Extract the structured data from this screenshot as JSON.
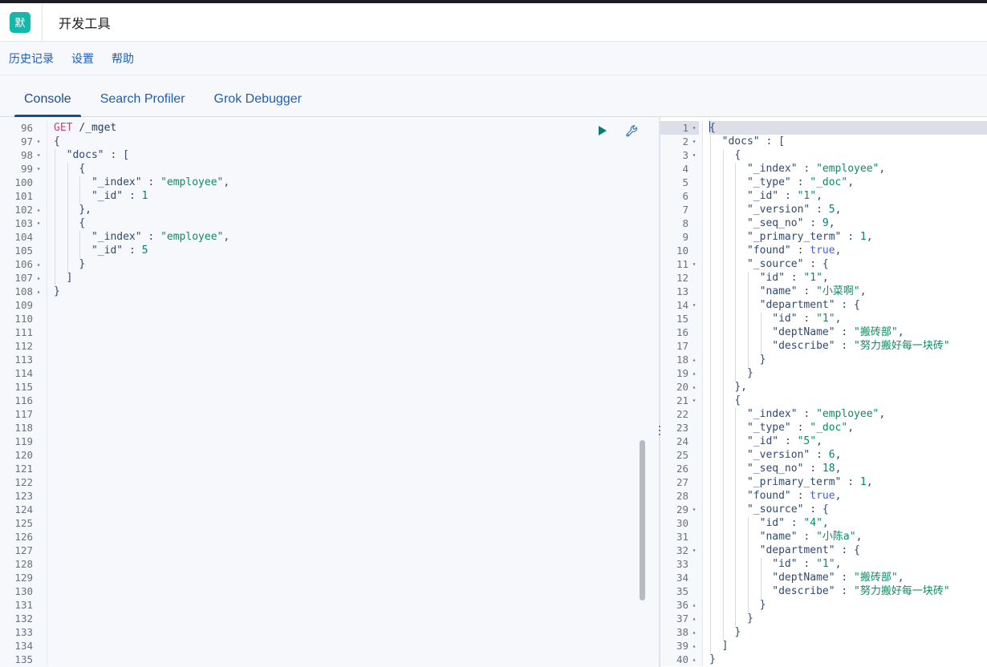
{
  "app": {
    "logo_text": "默",
    "title": "开发工具"
  },
  "nav": {
    "links": [
      {
        "label": "历史记录",
        "name": "history"
      },
      {
        "label": "设置",
        "name": "settings"
      },
      {
        "label": "帮助",
        "name": "help"
      }
    ]
  },
  "tabs": [
    {
      "label": "Console",
      "active": true
    },
    {
      "label": "Search Profiler",
      "active": false
    },
    {
      "label": "Grok Debugger",
      "active": false
    }
  ],
  "toolbar": {
    "send_icon": "play-icon",
    "send_label": "Click to send request",
    "wrench_icon": "wrench-icon",
    "wrench_label": "Open documentation"
  },
  "request_editor": {
    "first_line_number": 96,
    "last_line_number": 135,
    "lines": [
      {
        "n": 96,
        "fold": "",
        "text": "GET /_mget"
      },
      {
        "n": 97,
        "fold": "▾",
        "text": "{"
      },
      {
        "n": 98,
        "fold": "▾",
        "text": "  \"docs\" : ["
      },
      {
        "n": 99,
        "fold": "▾",
        "text": "    {"
      },
      {
        "n": 100,
        "fold": "",
        "text": "      \"_index\" : \"employee\","
      },
      {
        "n": 101,
        "fold": "",
        "text": "      \"_id\" : 1"
      },
      {
        "n": 102,
        "fold": "▴",
        "text": "    },"
      },
      {
        "n": 103,
        "fold": "▾",
        "text": "    {"
      },
      {
        "n": 104,
        "fold": "",
        "text": "      \"_index\" : \"employee\","
      },
      {
        "n": 105,
        "fold": "",
        "text": "      \"_id\" : 5"
      },
      {
        "n": 106,
        "fold": "▴",
        "text": "    }"
      },
      {
        "n": 107,
        "fold": "▴",
        "text": "  ]"
      },
      {
        "n": 108,
        "fold": "▴",
        "text": "}"
      },
      {
        "n": 109,
        "fold": "",
        "text": ""
      },
      {
        "n": 110,
        "fold": "",
        "text": ""
      },
      {
        "n": 111,
        "fold": "",
        "text": ""
      },
      {
        "n": 112,
        "fold": "",
        "text": ""
      },
      {
        "n": 113,
        "fold": "",
        "text": ""
      },
      {
        "n": 114,
        "fold": "",
        "text": ""
      },
      {
        "n": 115,
        "fold": "",
        "text": ""
      },
      {
        "n": 116,
        "fold": "",
        "text": ""
      },
      {
        "n": 117,
        "fold": "",
        "text": ""
      },
      {
        "n": 118,
        "fold": "",
        "text": ""
      },
      {
        "n": 119,
        "fold": "",
        "text": ""
      },
      {
        "n": 120,
        "fold": "",
        "text": ""
      },
      {
        "n": 121,
        "fold": "",
        "text": ""
      },
      {
        "n": 122,
        "fold": "",
        "text": ""
      },
      {
        "n": 123,
        "fold": "",
        "text": ""
      },
      {
        "n": 124,
        "fold": "",
        "text": ""
      },
      {
        "n": 125,
        "fold": "",
        "text": ""
      },
      {
        "n": 126,
        "fold": "",
        "text": ""
      },
      {
        "n": 127,
        "fold": "",
        "text": ""
      },
      {
        "n": 128,
        "fold": "",
        "text": ""
      },
      {
        "n": 129,
        "fold": "",
        "text": ""
      },
      {
        "n": 130,
        "fold": "",
        "text": ""
      },
      {
        "n": 131,
        "fold": "",
        "text": ""
      },
      {
        "n": 132,
        "fold": "",
        "text": ""
      },
      {
        "n": 133,
        "fold": "",
        "text": ""
      },
      {
        "n": 134,
        "fold": "",
        "text": ""
      },
      {
        "n": 135,
        "fold": "",
        "text": ""
      }
    ]
  },
  "response_editor": {
    "first_line_number": 1,
    "last_line_number": 40,
    "active_line": 1,
    "lines": [
      {
        "n": 1,
        "fold": "▾",
        "text": "{"
      },
      {
        "n": 2,
        "fold": "▾",
        "text": "  \"docs\" : ["
      },
      {
        "n": 3,
        "fold": "▾",
        "text": "    {"
      },
      {
        "n": 4,
        "fold": "",
        "text": "      \"_index\" : \"employee\","
      },
      {
        "n": 5,
        "fold": "",
        "text": "      \"_type\" : \"_doc\","
      },
      {
        "n": 6,
        "fold": "",
        "text": "      \"_id\" : \"1\","
      },
      {
        "n": 7,
        "fold": "",
        "text": "      \"_version\" : 5,"
      },
      {
        "n": 8,
        "fold": "",
        "text": "      \"_seq_no\" : 9,"
      },
      {
        "n": 9,
        "fold": "",
        "text": "      \"_primary_term\" : 1,"
      },
      {
        "n": 10,
        "fold": "",
        "text": "      \"found\" : true,"
      },
      {
        "n": 11,
        "fold": "▾",
        "text": "      \"_source\" : {"
      },
      {
        "n": 12,
        "fold": "",
        "text": "        \"id\" : \"1\","
      },
      {
        "n": 13,
        "fold": "",
        "text": "        \"name\" : \"小菜啊\","
      },
      {
        "n": 14,
        "fold": "▾",
        "text": "        \"department\" : {"
      },
      {
        "n": 15,
        "fold": "",
        "text": "          \"id\" : \"1\","
      },
      {
        "n": 16,
        "fold": "",
        "text": "          \"deptName\" : \"搬砖部\","
      },
      {
        "n": 17,
        "fold": "",
        "text": "          \"describe\" : \"努力搬好每一块砖\""
      },
      {
        "n": 18,
        "fold": "▴",
        "text": "        }"
      },
      {
        "n": 19,
        "fold": "▴",
        "text": "      }"
      },
      {
        "n": 20,
        "fold": "▴",
        "text": "    },"
      },
      {
        "n": 21,
        "fold": "▾",
        "text": "    {"
      },
      {
        "n": 22,
        "fold": "",
        "text": "      \"_index\" : \"employee\","
      },
      {
        "n": 23,
        "fold": "",
        "text": "      \"_type\" : \"_doc\","
      },
      {
        "n": 24,
        "fold": "",
        "text": "      \"_id\" : \"5\","
      },
      {
        "n": 25,
        "fold": "",
        "text": "      \"_version\" : 6,"
      },
      {
        "n": 26,
        "fold": "",
        "text": "      \"_seq_no\" : 18,"
      },
      {
        "n": 27,
        "fold": "",
        "text": "      \"_primary_term\" : 1,"
      },
      {
        "n": 28,
        "fold": "",
        "text": "      \"found\" : true,"
      },
      {
        "n": 29,
        "fold": "▾",
        "text": "      \"_source\" : {"
      },
      {
        "n": 30,
        "fold": "",
        "text": "        \"id\" : \"4\","
      },
      {
        "n": 31,
        "fold": "",
        "text": "        \"name\" : \"小陈a\","
      },
      {
        "n": 32,
        "fold": "▾",
        "text": "        \"department\" : {"
      },
      {
        "n": 33,
        "fold": "",
        "text": "          \"id\" : \"1\","
      },
      {
        "n": 34,
        "fold": "",
        "text": "          \"deptName\" : \"搬砖部\","
      },
      {
        "n": 35,
        "fold": "",
        "text": "          \"describe\" : \"努力搬好每一块砖\""
      },
      {
        "n": 36,
        "fold": "▴",
        "text": "        }"
      },
      {
        "n": 37,
        "fold": "▴",
        "text": "      }"
      },
      {
        "n": 38,
        "fold": "▴",
        "text": "    }"
      },
      {
        "n": 39,
        "fold": "▴",
        "text": "  ]"
      },
      {
        "n": 40,
        "fold": "▴",
        "text": "}"
      }
    ]
  },
  "colors": {
    "brand_teal": "#14b8ab",
    "link_blue": "#1c5eb8",
    "active_tab": "#1a4d8f",
    "method": "#c5407f",
    "string": "#0f8a5f",
    "number": "#0a7b7b",
    "boolean": "#4a5fcf",
    "key": "#30496e",
    "editor_bg": "#f7f8fc",
    "response_bg": "#ffffff"
  }
}
